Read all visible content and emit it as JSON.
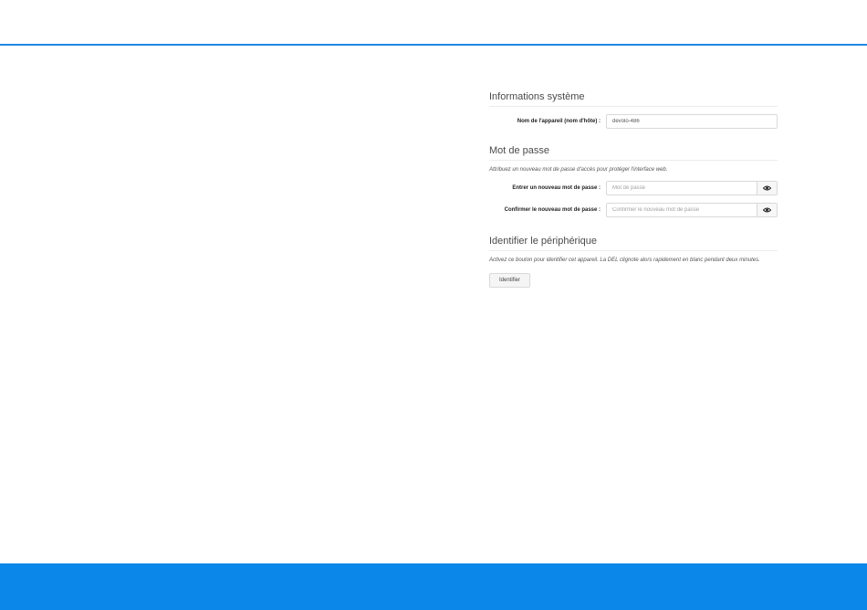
{
  "system_info": {
    "title": "Informations système",
    "hostname_label": "Nom de l'appareil (nom d'hôte) :",
    "hostname_value": "devolo-486"
  },
  "password": {
    "title": "Mot de passe",
    "description": "Attribuez un nouveau mot de passe d'accès pour protéger l'interface web.",
    "new_label": "Entrer un nouveau mot de passe :",
    "new_placeholder": "Mot de passe",
    "confirm_label": "Confirmer le nouveau mot de passe :",
    "confirm_placeholder": "Confirmer le nouveau mot de passe",
    "toggle_icon": "eye-icon"
  },
  "identify": {
    "title": "Identifier le périphérique",
    "description": "Activez ce bouton pour identifier cet appareil. La DEL clignote alors rapidement en blanc pendant deux minutes.",
    "button_label": "Identifier"
  },
  "colors": {
    "accent": "#1e88e5",
    "footer": "#0a87e8"
  }
}
